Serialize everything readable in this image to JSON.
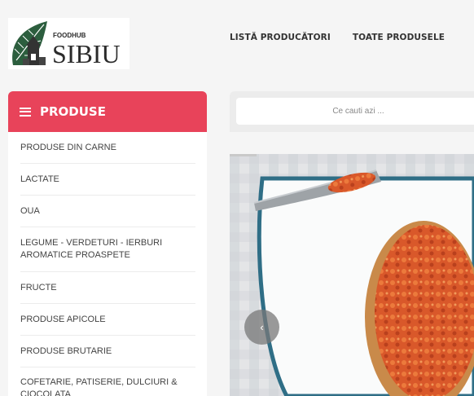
{
  "logo": {
    "small_text": "FOODHUB",
    "big_text": "SIBIU"
  },
  "nav": [
    "LISTĂ PRODUCĂTORI",
    "TOATE PRODUSELE"
  ],
  "sidebar": {
    "title": "PRODUSE",
    "categories": [
      "PRODUSE DIN CARNE",
      "LACTATE",
      "OUA",
      "LEGUME - VERDETURI - IERBURI AROMATICE PROASPETE",
      "FRUCTE",
      "PRODUSE APICOLE",
      "PRODUSE BRUTARIE",
      "COFETARIE, PATISERIE, DULCIURI & CIOCOLATA"
    ]
  },
  "search": {
    "placeholder": "Ce cauti azi ..."
  },
  "carousel": {
    "prev_icon": "‹"
  },
  "colors": {
    "accent": "#e8435a",
    "background": "#f5f5f5"
  }
}
